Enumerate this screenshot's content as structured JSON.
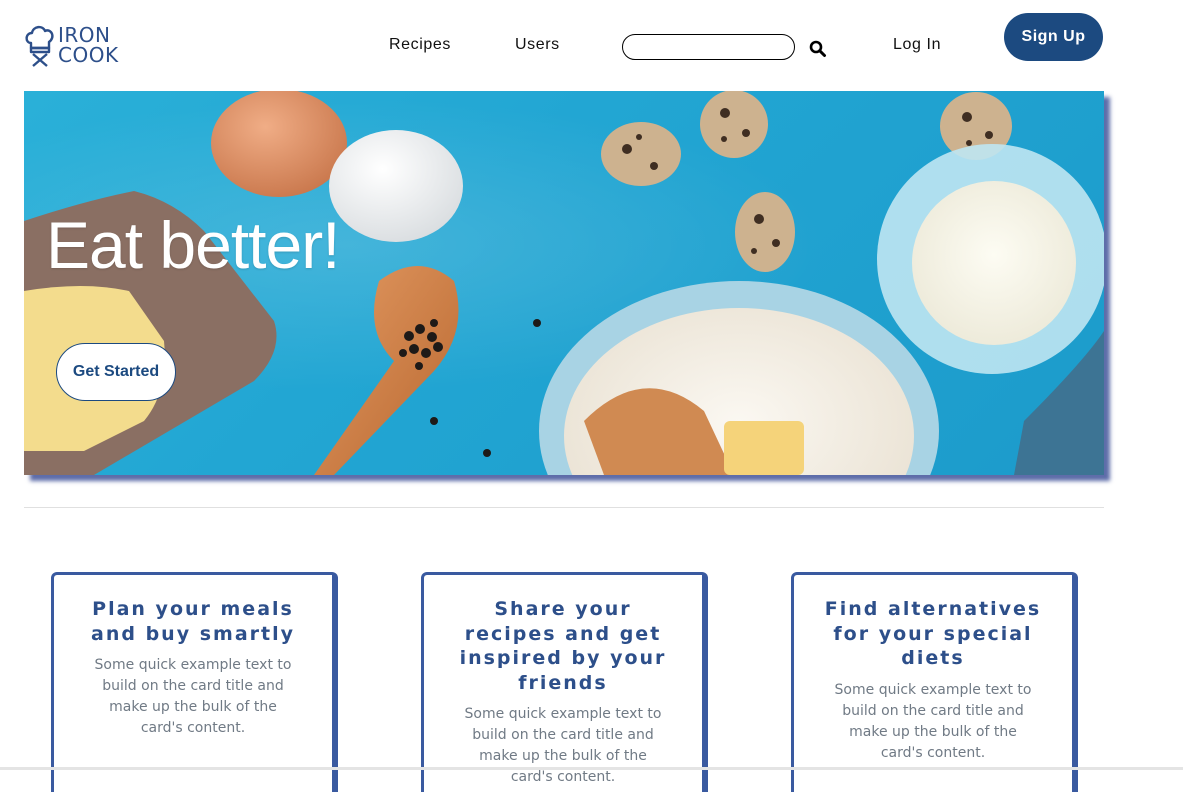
{
  "brand": {
    "line1": "IRON",
    "line2": "COOK",
    "color": "#2d4f8a"
  },
  "nav": {
    "links": [
      "Recipes",
      "Users"
    ],
    "search_placeholder": "",
    "search_icon": "search-icon",
    "login": "Log In",
    "signup": "Sign Up"
  },
  "hero": {
    "headline": "Eat better!",
    "cta": "Get Started"
  },
  "cards": [
    {
      "title": "Plan your meals and buy smartly",
      "text": "Some quick example text to build on the card title and make up the bulk of the card's content."
    },
    {
      "title": "Share your recipes and get inspired by your friends",
      "text": "Some quick example text to build on the card title and make up the bulk of the card's content."
    },
    {
      "title": "Find alternatives for your special diets",
      "text": "Some quick example text to build on the card title and make up the bulk of the card's content."
    }
  ],
  "colors": {
    "primary": "#1c4a80",
    "card_border": "#3a5aa0",
    "hero_bg": "#22a6d3"
  }
}
